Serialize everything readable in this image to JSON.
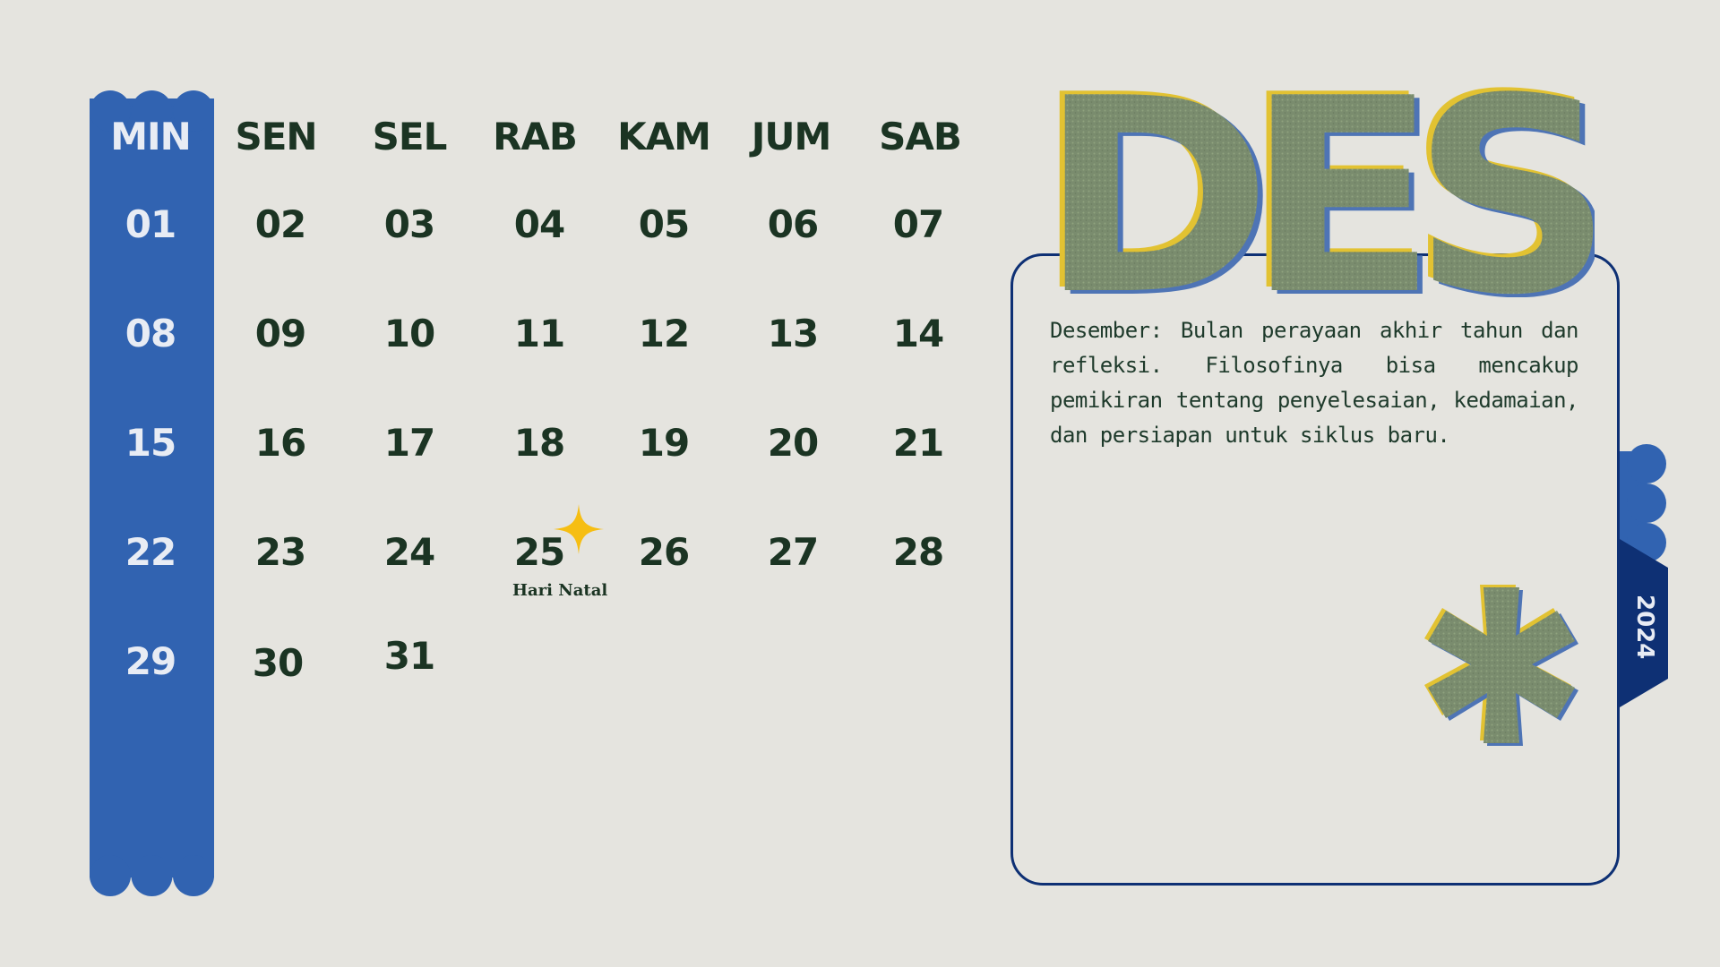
{
  "calendar": {
    "weekdays": [
      "MIN",
      "SEN",
      "SEL",
      "RAB",
      "KAM",
      "JUM",
      "SAB"
    ],
    "weeks": [
      [
        "01",
        "02",
        "03",
        "04",
        "05",
        "06",
        "07"
      ],
      [
        "08",
        "09",
        "10",
        "11",
        "12",
        "13",
        "14"
      ],
      [
        "15",
        "16",
        "17",
        "18",
        "19",
        "20",
        "21"
      ],
      [
        "22",
        "23",
        "24",
        "25",
        "26",
        "27",
        "28"
      ],
      [
        "29",
        "30",
        "31"
      ]
    ],
    "holiday": {
      "day": "25",
      "label": "Hari Natal",
      "icon": "sparkle-icon"
    }
  },
  "month": {
    "title": "DES"
  },
  "year": "2024",
  "note": "Desember: Bulan perayaan akhir tahun dan refleksi. Filosofinya bisa mencakup pemikiran tentang penyelesaian, kedamaian, dan persiapan untuk siklus baru.",
  "colors": {
    "background": "#E5E4DF",
    "sunday_column": "#3163B1",
    "text_dark": "#1B3423",
    "card_border": "#0E3074",
    "title_fill": "#7A8C6E",
    "title_shadow_yellow": "#E2C232",
    "title_shadow_blue": "#4E74B5",
    "sparkle": "#F6BE13",
    "year_tab": "#0E3074"
  },
  "decorations": {
    "asterisk_icon": "asterisk-icon"
  }
}
